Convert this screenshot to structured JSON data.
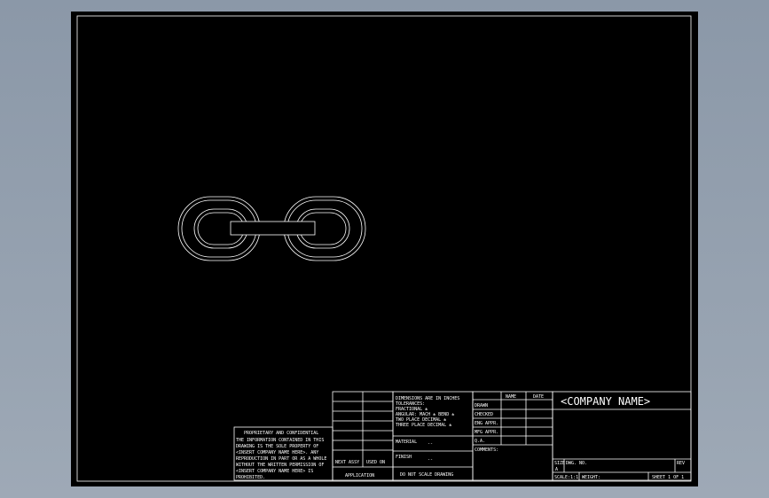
{
  "title_block": {
    "company_name": "<COMPANY NAME>",
    "tolerances": [
      "DIMENSIONS ARE IN INCHES",
      "TOLERANCES:",
      "FRACTIONAL ±",
      "ANGULAR: MACH ±   BEND ±",
      "TWO PLACE DECIMAL   ±",
      "THREE PLACE DECIMAL  ±"
    ],
    "material_label": "MATERIAL",
    "material_value": "--",
    "finish_label": "FINISH",
    "finish_value": "--",
    "no_scale": "DO NOT SCALE DRAWING",
    "name_header": "NAME",
    "date_header": "DATE",
    "approvals": [
      "DRAWN",
      "CHECKED",
      "ENG APPR.",
      "MFG APPR.",
      "Q.A."
    ],
    "comments_label": "COMMENTS:",
    "size_label": "SIZE",
    "size_value": "A",
    "dwg_no_label": "DWG. NO.",
    "rev_label": "REV",
    "scale_label": "SCALE:1:1",
    "weight_label": "WEIGHT:",
    "sheet_label": "SHEET 1 OF 1",
    "next_assy": "NEXT ASSY",
    "used_on": "USED ON",
    "application": "APPLICATION"
  },
  "proprietary": {
    "heading": "PROPRIETARY AND CONFIDENTIAL",
    "lines": [
      "THE INFORMATION CONTAINED IN THIS",
      "DRAWING IS THE SOLE PROPERTY OF",
      "<INSERT COMPANY NAME HERE>. ANY",
      "REPRODUCTION IN PART OR AS A WHOLE",
      "WITHOUT THE WRITTEN PERMISSION OF",
      "<INSERT COMPANY NAME HERE> IS",
      "PROHIBITED."
    ]
  }
}
